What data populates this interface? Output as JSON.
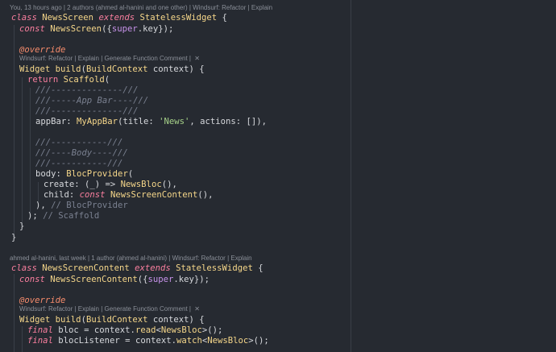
{
  "editor": {
    "blame1": "You, 13 hours ago | 2 authors (ahmed al-hanini and one other) | Windsurf: Refactor | Explain",
    "blame2": "ahmed al-hanini, last week | 1 author (ahmed al-hanini) | Windsurf: Refactor | Explain",
    "codelens": "Windsurf: Refactor | Explain | Generate Function Comment | ",
    "close_icon": "✕",
    "lines": {
      "l1": {
        "a": "class",
        "b": "NewsScreen",
        "c": "extends",
        "d": "StatelessWidget",
        "e": " {"
      },
      "l2": {
        "a": "const",
        "b": "NewsScreen",
        "c": "({",
        "d": "super",
        "e": ".key});"
      },
      "l3": {
        "a": "@override"
      },
      "l4": {
        "a": "Widget",
        "b": "build",
        "c": "(",
        "d": "BuildContext",
        "e": " context) {"
      },
      "l5": {
        "a": "return",
        "b": "Scaffold",
        "c": "("
      },
      "l6": {
        "a": "///--------------///"
      },
      "l7": {
        "a": "///-----App Bar----///"
      },
      "l8": {
        "a": "///--------------///"
      },
      "l9": {
        "a": "appBar: ",
        "b": "MyAppBar",
        "c": "(title: ",
        "d": "'News'",
        "e": ", actions: []),"
      },
      "l10": {
        "a": "///-----------///"
      },
      "l11": {
        "a": "///----Body----///"
      },
      "l12": {
        "a": "///-----------///"
      },
      "l13": {
        "a": "body: ",
        "b": "BlocProvider",
        "c": "("
      },
      "l14": {
        "a": "create: (_) => ",
        "b": "NewsBloc",
        "c": "(),"
      },
      "l15": {
        "a": "child: ",
        "b": "const",
        "c": "NewsScreenContent",
        "d": "(),"
      },
      "l16": {
        "a": "), ",
        "b": "// BlocProvider"
      },
      "l17": {
        "a": "); ",
        "b": "// Scaffold"
      },
      "l18": {
        "a": "}"
      },
      "l19": {
        "a": "}"
      },
      "l20": {
        "a": "class",
        "b": "NewsScreenContent",
        "c": "extends",
        "d": "StatelessWidget",
        "e": " {"
      },
      "l21": {
        "a": "const",
        "b": "NewsScreenContent",
        "c": "({",
        "d": "super",
        "e": ".key});"
      },
      "l22": {
        "a": "@override"
      },
      "l23": {
        "a": "Widget",
        "b": "build",
        "c": "(",
        "d": "BuildContext",
        "e": " context) {"
      },
      "l24": {
        "a": "final",
        "b": " bloc = context.",
        "c": "read",
        "d": "<",
        "e": "NewsBloc",
        "f": ">();"
      },
      "l25": {
        "a": "final",
        "b": " blocListener = context.",
        "c": "watch",
        "d": "<",
        "e": "NewsBloc",
        "f": ">();"
      }
    }
  }
}
